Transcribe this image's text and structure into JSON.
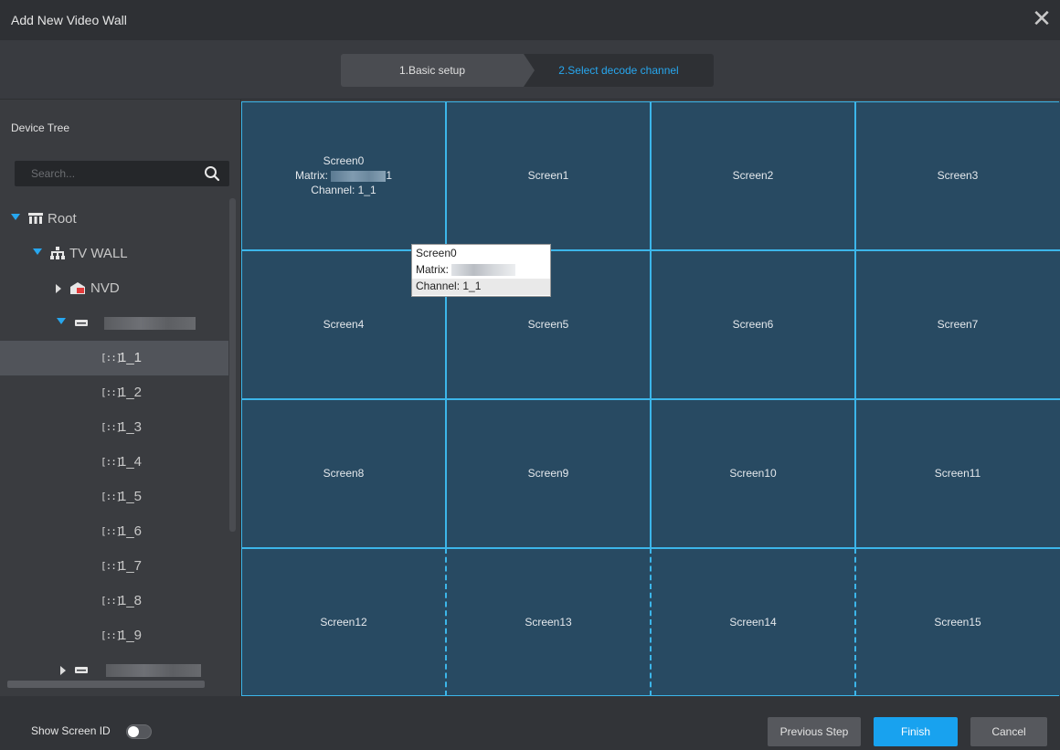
{
  "window": {
    "title": "Add New Video Wall",
    "close_glyph": "✕"
  },
  "steps": [
    {
      "label": "1.Basic setup"
    },
    {
      "label": "2.Select decode channel"
    }
  ],
  "sidebar": {
    "title": "Device Tree",
    "search": {
      "placeholder": "Search...",
      "value": ""
    },
    "tree": {
      "root": "Root",
      "tv_wall": "TV WALL",
      "nvd": "NVD",
      "channels": [
        "1_1",
        "1_2",
        "1_3",
        "1_4",
        "1_5",
        "1_6",
        "1_7",
        "1_8",
        "1_9"
      ],
      "selected_channel": "1_1"
    }
  },
  "wall": {
    "screens": [
      "Screen0",
      "Screen1",
      "Screen2",
      "Screen3",
      "Screen4",
      "Screen5",
      "Screen6",
      "Screen7",
      "Screen8",
      "Screen9",
      "Screen10",
      "Screen11",
      "Screen12",
      "Screen13",
      "Screen14",
      "Screen15"
    ],
    "screen0_detail": {
      "name": "Screen0",
      "matrix_label": "Matrix:",
      "matrix_suffix": "1",
      "channel": "Channel: 1_1"
    },
    "tooltip": {
      "name": "Screen0",
      "matrix_label": "Matrix:",
      "channel": "Channel: 1_1"
    }
  },
  "footer": {
    "show_screen_id_label": "Show Screen ID",
    "show_screen_id_on": false,
    "previous_label": "Previous Step",
    "finish_label": "Finish",
    "cancel_label": "Cancel"
  },
  "colors": {
    "accent": "#18a2ef",
    "grid_line": "#3cb6ea",
    "screen_bg": "#284a62"
  }
}
